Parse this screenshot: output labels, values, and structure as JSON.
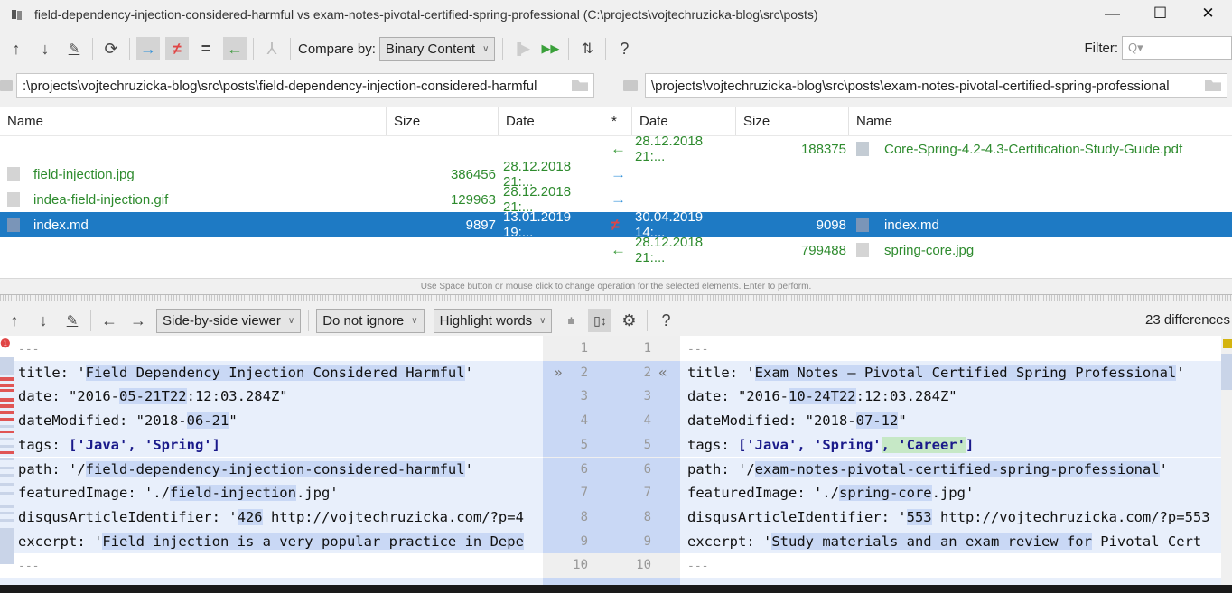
{
  "window": {
    "title": "field-dependency-injection-considered-harmful vs exam-notes-pivotal-certified-spring-professional (C:\\projects\\vojtechruzicka-blog\\src\\posts)",
    "controls": {
      "minimize": "—",
      "maximize": "☐",
      "close": "✕"
    }
  },
  "toolbar": {
    "compare_by_label": "Compare by:",
    "compare_by_value": "Binary Content",
    "help": "?",
    "filter_label": "Filter:",
    "filter_placeholder": "Q▾"
  },
  "paths": {
    "left": ":\\projects\\vojtechruzicka-blog\\src\\posts\\field-dependency-injection-considered-harmful",
    "right": "\\projects\\vojtechruzicka-blog\\src\\posts\\exam-notes-pivotal-certified-spring-professional"
  },
  "columns": {
    "left_name": "Name",
    "left_size": "Size",
    "left_date": "Date",
    "op": "*",
    "right_date": "Date",
    "right_size": "Size",
    "right_name": "Name"
  },
  "files": [
    {
      "left_name": "",
      "left_size": "",
      "left_date": "",
      "op": "←",
      "op_type": "left",
      "right_date": "28.12.2018 21:...",
      "right_size": "188375",
      "right_name": "Core-Spring-4.2-4.3-Certification-Study-Guide.pdf",
      "right_icon": "pdf",
      "selected": false
    },
    {
      "left_name": "field-injection.jpg",
      "left_icon": "image",
      "left_size": "386456",
      "left_date": "28.12.2018 21:...",
      "op": "→",
      "op_type": "right",
      "right_date": "",
      "right_size": "",
      "right_name": "",
      "selected": false
    },
    {
      "left_name": "indea-field-injection.gif",
      "left_icon": "image",
      "left_size": "129963",
      "left_date": "28.12.2018 21:...",
      "op": "→",
      "op_type": "right",
      "right_date": "",
      "right_size": "",
      "right_name": "",
      "selected": false
    },
    {
      "left_name": "index.md",
      "left_icon": "md",
      "left_size": "9897",
      "left_date": "13.01.2019 19:...",
      "op": "≠",
      "op_type": "neq",
      "right_date": "30.04.2019 14:...",
      "right_size": "9098",
      "right_name": "index.md",
      "right_icon": "md",
      "selected": true
    },
    {
      "left_name": "",
      "left_size": "",
      "left_date": "",
      "op": "←",
      "op_type": "left",
      "right_date": "28.12.2018 21:...",
      "right_size": "799488",
      "right_name": "spring-core.jpg",
      "right_icon": "image",
      "selected": false
    }
  ],
  "status_hint": "Use Space button or mouse click to change operation for the selected elements. Enter to perform.",
  "diff_toolbar": {
    "viewer": "Side-by-side viewer",
    "ignore": "Do not ignore",
    "highlight": "Highlight words",
    "help": "?",
    "differences": "23 differences"
  },
  "diff": {
    "line_numbers": [
      "1",
      "2",
      "3",
      "4",
      "5",
      "6",
      "7",
      "8",
      "9",
      "10"
    ],
    "left": [
      {
        "pre": "---",
        "dash": true
      },
      {
        "pre": "title: '",
        "hl": "Field Dependency Injection Considered Harmful",
        "post": "'"
      },
      {
        "pre": "date: \"2016-",
        "hl": "05-21T22",
        "post": ":12:03.284Z\""
      },
      {
        "pre": "dateModified: \"2018-",
        "hl": "06-21",
        "post": "\""
      },
      {
        "pre": "tags: ",
        "str": "['Java', 'Spring']"
      },
      {
        "pre": "path: '/",
        "hl": "field-dependency-injection-considered-harmful",
        "post": "'"
      },
      {
        "pre": "featuredImage: './",
        "hl": "field-injection",
        "post": ".jpg'"
      },
      {
        "pre": "disqusArticleIdentifier: '",
        "hl": "426",
        "post": " http://vojtechruzicka.com/?p=4"
      },
      {
        "pre": "excerpt: '",
        "hl": "Field injection is a very popular practice in Depe",
        "post": ""
      },
      {
        "pre": "---",
        "dash": true
      }
    ],
    "right": [
      {
        "pre": "---",
        "dash": true
      },
      {
        "pre": "title: '",
        "hl": "Exam Notes – Pivotal Certified Spring Professional",
        "post": "'"
      },
      {
        "pre": "date: \"2016-",
        "hl": "10-24T22",
        "post": ":12:03.284Z\""
      },
      {
        "pre": "dateModified: \"2018-",
        "hl": "07-12",
        "post": "\""
      },
      {
        "pre": "tags: ",
        "str": "['Java', 'Spring'",
        "add": ", 'Career'",
        "str2": "]"
      },
      {
        "pre": "path: '/",
        "hl": "exam-notes-pivotal-certified-spring-professional",
        "post": "'"
      },
      {
        "pre": "featuredImage: './",
        "hl": "spring-core",
        "post": ".jpg'"
      },
      {
        "pre": "disqusArticleIdentifier: '",
        "hl": "553",
        "post": " http://vojtechruzicka.com/?p=553"
      },
      {
        "pre": "excerpt: '",
        "hl": "Study materials and an exam review for",
        "post": " Pivotal Cert"
      },
      {
        "pre": "---",
        "dash": true
      }
    ]
  },
  "colors": {
    "selection": "#1e7ac4",
    "added_green": "#2e8b2e",
    "copy_right_blue": "#2d8fd8",
    "different_red": "#e04545",
    "change_highlight": "#c9d8f5",
    "insert_highlight": "#c6e8c6"
  }
}
